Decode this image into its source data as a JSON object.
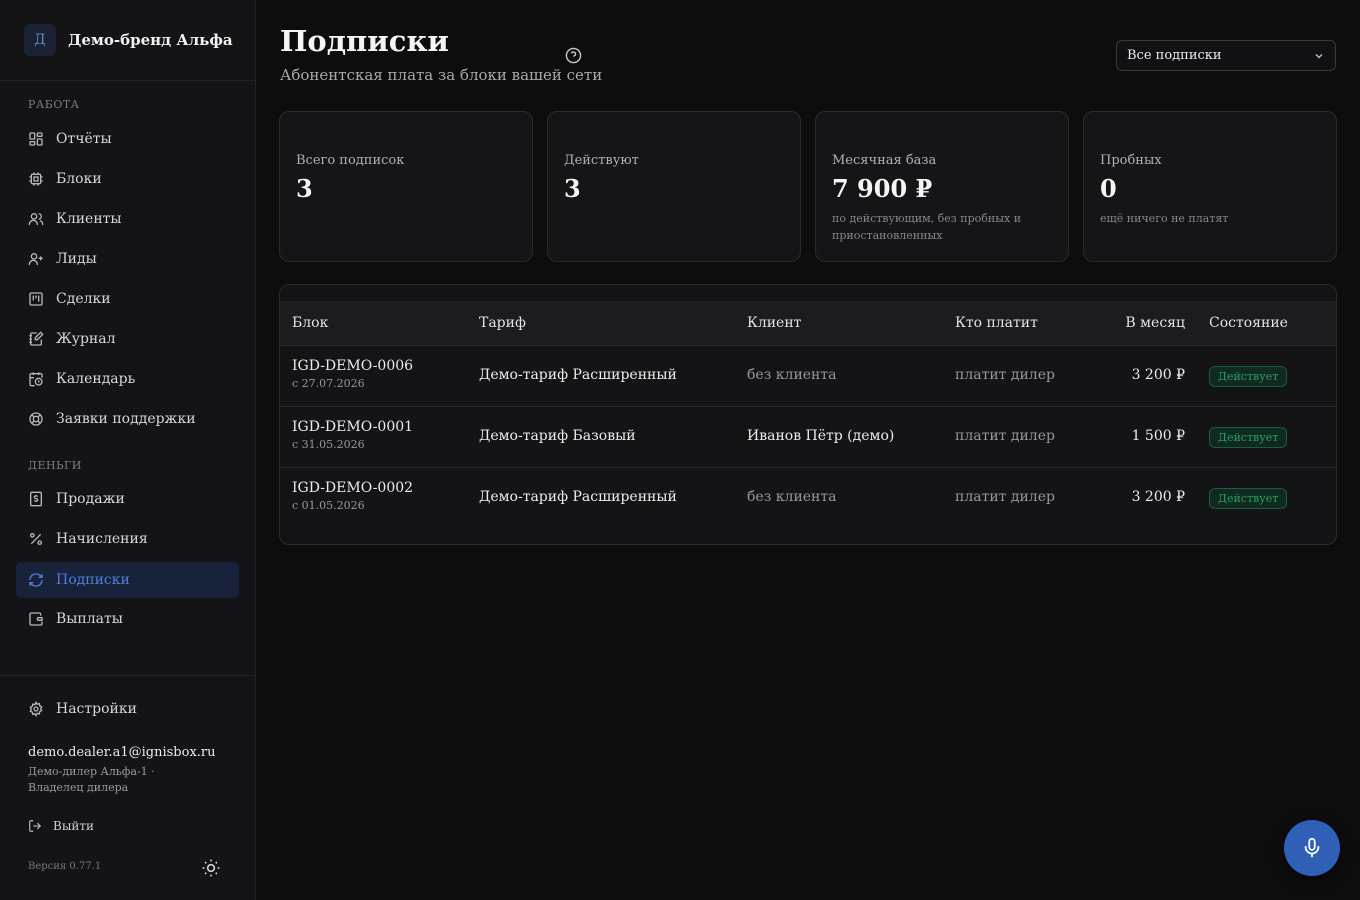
{
  "brand": {
    "logo_letter": "Д",
    "name": "Демо-бренд Альфа"
  },
  "sidebar": {
    "sections": {
      "work": "РАБОТА",
      "money": "ДЕНЬГИ"
    },
    "work_items": [
      {
        "label": "Отчёты",
        "icon": "dashboard-icon"
      },
      {
        "label": "Блоки",
        "icon": "chip-icon"
      },
      {
        "label": "Клиенты",
        "icon": "users-icon"
      },
      {
        "label": "Лиды",
        "icon": "user-plus-icon"
      },
      {
        "label": "Сделки",
        "icon": "kanban-icon"
      },
      {
        "label": "Журнал",
        "icon": "notebook-pen-icon"
      },
      {
        "label": "Календарь",
        "icon": "calendar-clock-icon"
      },
      {
        "label": "Заявки поддержки",
        "icon": "lifebuoy-icon"
      }
    ],
    "money_items": [
      {
        "label": "Продажи",
        "icon": "receipt-icon"
      },
      {
        "label": "Начисления",
        "icon": "percent-icon"
      },
      {
        "label": "Подписки",
        "icon": "refresh-icon",
        "active": true
      },
      {
        "label": "Выплаты",
        "icon": "wallet-icon"
      }
    ],
    "settings_label": "Настройки",
    "user": {
      "email": "demo.dealer.a1@ignisbox.ru",
      "role": "Демо-дилер Альфа-1 · Владелец дилера"
    },
    "logout_label": "Выйти",
    "version": "Версия 0.77.1"
  },
  "header": {
    "title": "Подписки",
    "subtitle": "Абонентская плата за блоки вашей сети",
    "filter_value": "Все подписки"
  },
  "stats": [
    {
      "label": "Всего подписок",
      "value": "3",
      "note": ""
    },
    {
      "label": "Действуют",
      "value": "3",
      "note": ""
    },
    {
      "label": "Месячная база",
      "value": "7 900 ₽",
      "note": "по действующим, без пробных и приостановленных"
    },
    {
      "label": "Пробных",
      "value": "0",
      "note": "ещё ничего не платят"
    }
  ],
  "table": {
    "columns": [
      "Блок",
      "Тариф",
      "Клиент",
      "Кто платит",
      "В месяц",
      "Состояние"
    ],
    "rows": [
      {
        "block": "IGD-DEMO-0006",
        "since": "с 27.07.2026",
        "plan": "Демо-тариф Расширенный",
        "client": "без клиента",
        "payer": "платит дилер",
        "amount": "3 200 ₽",
        "status": "Действует"
      },
      {
        "block": "IGD-DEMO-0001",
        "since": "с 31.05.2026",
        "plan": "Демо-тариф Базовый",
        "client": "Иванов Пётр (демо)",
        "payer": "платит дилер",
        "amount": "1 500 ₽",
        "status": "Действует"
      },
      {
        "block": "IGD-DEMO-0002",
        "since": "с 01.05.2026",
        "plan": "Демо-тариф Расширенный",
        "client": "без клиента",
        "payer": "платит дилер",
        "amount": "3 200 ₽",
        "status": "Действует"
      }
    ]
  },
  "colors": {
    "accent": "#2f5fb6",
    "active_nav": "#4f7fd9",
    "status_green": "#2f9d66",
    "background": "#0d0d0e"
  }
}
